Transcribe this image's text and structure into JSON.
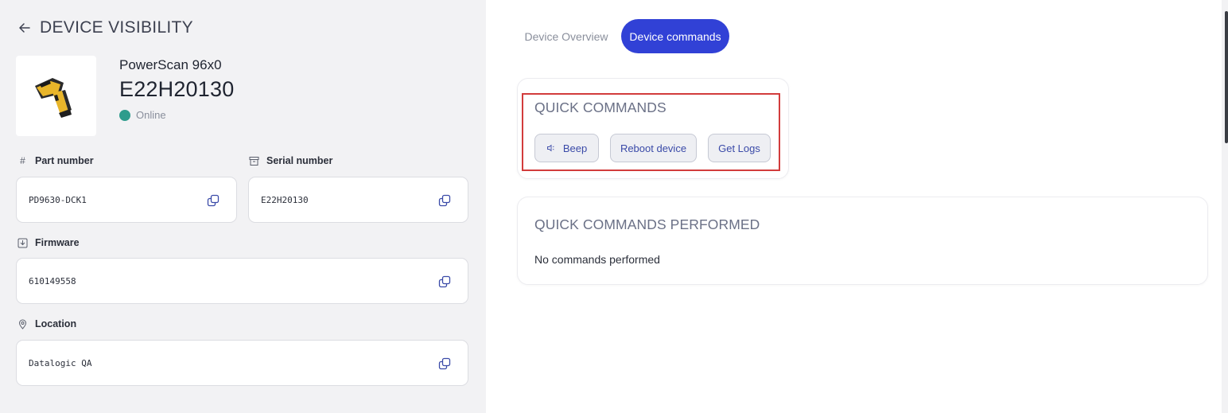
{
  "header": {
    "title": "DEVICE VISIBILITY"
  },
  "device": {
    "model": "PowerScan 96x0",
    "serial": "E22H20130",
    "status": "Online",
    "status_color": "#2e9c8c"
  },
  "fields": {
    "part_number": {
      "label": "Part number",
      "value": "PD9630-DCK1"
    },
    "serial_number": {
      "label": "Serial number",
      "value": "E22H20130"
    },
    "firmware": {
      "label": "Firmware",
      "value": "610149558"
    },
    "location": {
      "label": "Location",
      "value": "Datalogic QA"
    }
  },
  "tabs": [
    {
      "label": "Device Overview",
      "active": false
    },
    {
      "label": "Device commands",
      "active": true
    }
  ],
  "quick_commands": {
    "title": "QUICK COMMANDS",
    "buttons": [
      {
        "label": "Beep",
        "icon": "speaker-icon"
      },
      {
        "label": "Reboot device"
      },
      {
        "label": "Get Logs"
      }
    ]
  },
  "performed": {
    "title": "QUICK COMMANDS PERFORMED",
    "empty_text": "No commands performed"
  },
  "colors": {
    "accent": "#3141d6",
    "highlight": "#d23c3c",
    "panel_bg": "#f2f2f4"
  }
}
